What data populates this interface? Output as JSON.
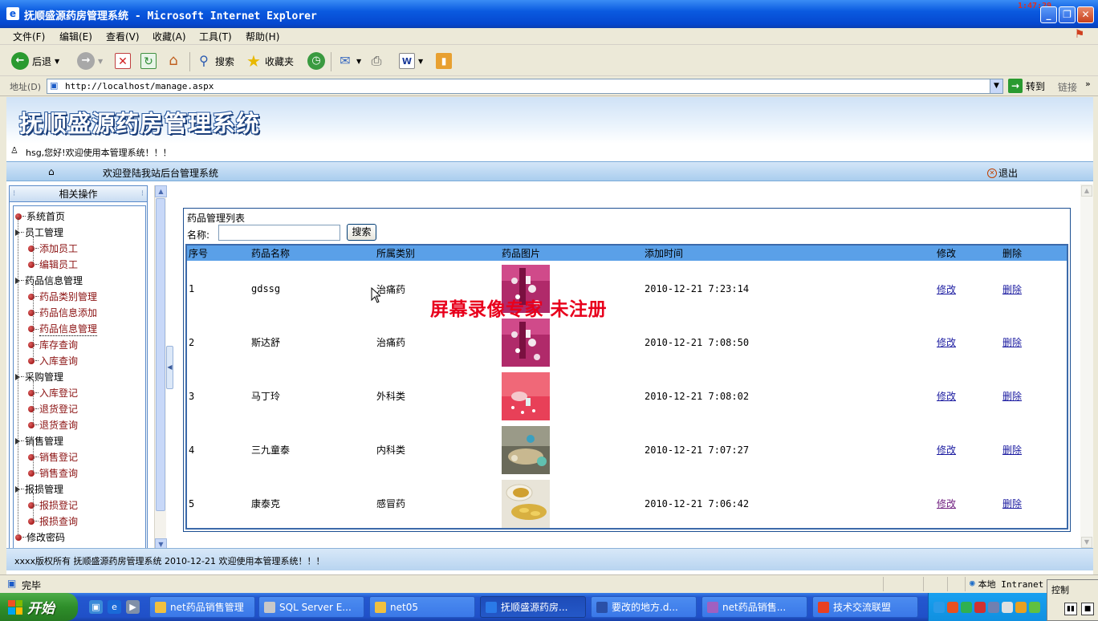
{
  "window": {
    "title": "抚顺盛源药房管理系统 - Microsoft Internet Explorer",
    "clock": "1:47:29"
  },
  "menu": [
    "文件(F)",
    "编辑(E)",
    "查看(V)",
    "收藏(A)",
    "工具(T)",
    "帮助(H)"
  ],
  "toolbar": {
    "back": "后退",
    "search": "搜索",
    "favorites": "收藏夹"
  },
  "address": {
    "label": "地址(D)",
    "url": "http://localhost/manage.aspx",
    "go": "转到",
    "links": "链接"
  },
  "site": {
    "title": "抚顺盛源药房管理系统",
    "welcome": "hsg,您好!欢迎使用本管理系统！！！",
    "nav_text": "欢迎登陆我站后台管理系统",
    "logout": "退出",
    "footer": "xxxx版权所有 抚顺盛源药房管理系统 2010-12-21 欢迎使用本管理系统！！！"
  },
  "sidebar": {
    "header": "相关操作",
    "items": [
      {
        "label": "系统首页",
        "level": 0
      },
      {
        "label": "员工管理",
        "level": 0,
        "group": true
      },
      {
        "label": "添加员工",
        "level": 1
      },
      {
        "label": "编辑员工",
        "level": 1
      },
      {
        "label": "药品信息管理",
        "level": 0,
        "group": true
      },
      {
        "label": "药品类别管理",
        "level": 1
      },
      {
        "label": "药品信息添加",
        "level": 1
      },
      {
        "label": "药品信息管理",
        "level": 1,
        "selected": true
      },
      {
        "label": "库存查询",
        "level": 1
      },
      {
        "label": "入库查询",
        "level": 1
      },
      {
        "label": "采购管理",
        "level": 0,
        "group": true
      },
      {
        "label": "入库登记",
        "level": 1
      },
      {
        "label": "退货登记",
        "level": 1
      },
      {
        "label": "退货查询",
        "level": 1
      },
      {
        "label": "销售管理",
        "level": 0,
        "group": true
      },
      {
        "label": "销售登记",
        "level": 1
      },
      {
        "label": "销售查询",
        "level": 1
      },
      {
        "label": "报损管理",
        "level": 0,
        "group": true
      },
      {
        "label": "报损登记",
        "level": 1
      },
      {
        "label": "报损查询",
        "level": 1
      },
      {
        "label": "修改密码",
        "level": 0
      }
    ]
  },
  "drugs": {
    "title": "药品管理列表",
    "name_label": "名称:",
    "search_value": "",
    "search_button": "搜索",
    "columns": [
      "序号",
      "药品名称",
      "所属类别",
      "药品图片",
      "添加时间",
      "修改",
      "删除"
    ],
    "rows": [
      {
        "id": "1",
        "name": "gdssg",
        "category": "治痛药",
        "time": "2010-12-21 7:23:14",
        "edit": "修改",
        "del": "删除",
        "img": "pink"
      },
      {
        "id": "2",
        "name": "斯达舒",
        "category": "治痛药",
        "time": "2010-12-21 7:08:50",
        "edit": "修改",
        "del": "删除",
        "img": "pink"
      },
      {
        "id": "3",
        "name": "马丁玲",
        "category": "外科类",
        "time": "2010-12-21 7:08:02",
        "edit": "修改",
        "del": "删除",
        "img": "red"
      },
      {
        "id": "4",
        "name": "三九童泰",
        "category": "内科类",
        "time": "2010-12-21 7:07:27",
        "edit": "修改",
        "del": "删除",
        "img": "dark"
      },
      {
        "id": "5",
        "name": "康泰克",
        "category": "感冒药",
        "time": "2010-12-21 7:06:42",
        "edit": "修改",
        "del": "删除",
        "img": "yellow"
      }
    ]
  },
  "watermark": "屏幕录像专家 未注册",
  "status": {
    "text": "完毕",
    "zone": "本地 Intranet"
  },
  "popup": {
    "label": "控制"
  },
  "taskbar": {
    "start": "开始",
    "tasks": [
      {
        "label": "net药品销售管理",
        "icon": "folder"
      },
      {
        "label": "SQL Server E...",
        "icon": "sql"
      },
      {
        "label": "net05",
        "icon": "folder"
      },
      {
        "label": "抚顺盛源药房...",
        "icon": "ie",
        "active": true
      },
      {
        "label": "要改的地方.d...",
        "icon": "word"
      },
      {
        "label": "net药品销售...",
        "icon": "vs"
      },
      {
        "label": "技术交流联盟",
        "icon": "qq"
      }
    ]
  }
}
